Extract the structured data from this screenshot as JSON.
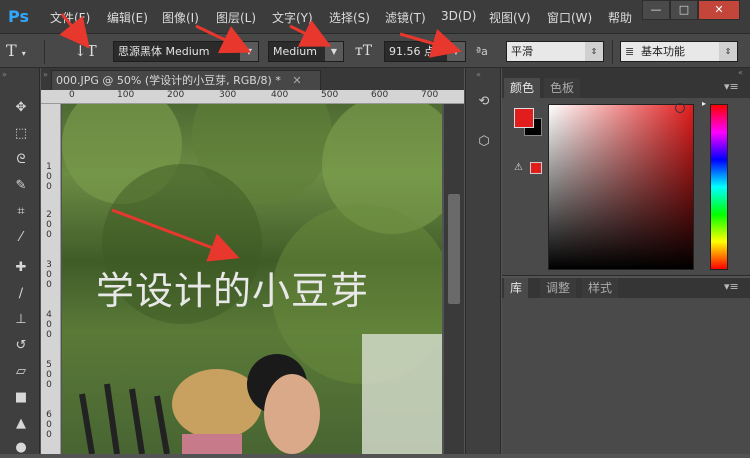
{
  "app_logo": "Ps",
  "menu": [
    "文件(F)",
    "编辑(E)",
    "图像(I)",
    "图层(L)",
    "文字(Y)",
    "选择(S)",
    "滤镜(T)",
    "3D(D)",
    "视图(V)",
    "窗口(W)",
    "帮助"
  ],
  "window_controls": {
    "minimize": "—",
    "maximize": "□",
    "close": "✕"
  },
  "options": {
    "font_family": "思源黑体 Medium",
    "font_style": "Medium",
    "font_size": "91.56 点",
    "antialias_icon_label": "ªa",
    "antialias": "平滑",
    "workspace": "基本功能"
  },
  "document": {
    "tab_title": "000.JPG @ 50% (学设计的小豆芽, RGB/8) *",
    "canvas_text": "学设计的小豆芽",
    "ruler_top": [
      "0",
      "100",
      "200",
      "300",
      "400",
      "500",
      "600",
      "700"
    ],
    "ruler_left": [
      "1\n0\n0",
      "2\n0\n0",
      "3\n0\n0",
      "4\n0\n0",
      "5\n0\n0",
      "6\n0\n0"
    ]
  },
  "panels": {
    "color_tabs": [
      "颜色",
      "色板"
    ],
    "library_tabs": [
      "库",
      "调整",
      "样式"
    ]
  },
  "colors": {
    "foreground": "#e21d1d",
    "background": "#000000",
    "annotation_arrow": "#e8372d",
    "accent": "#31a8ff"
  },
  "annotations": {
    "arrow_count": 5
  }
}
